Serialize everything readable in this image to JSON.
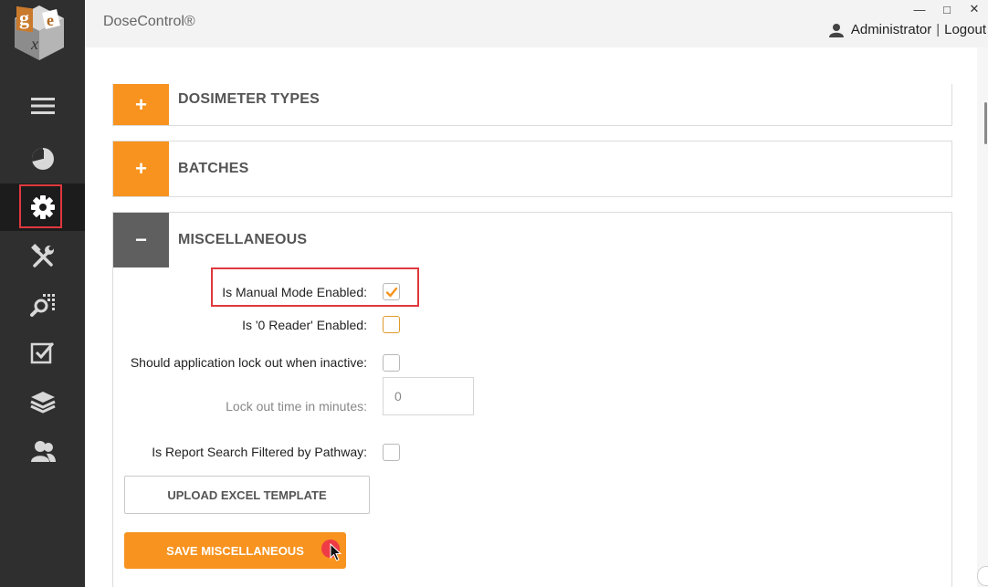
{
  "app": {
    "title": "DoseControl®",
    "logo_letters": [
      "g",
      "e",
      "x"
    ]
  },
  "window_controls": {
    "minimize": "—",
    "maximize": "□",
    "close": "✕"
  },
  "user": {
    "name": "Administrator",
    "separator": "|",
    "logout": "Logout",
    "icon": "user-icon"
  },
  "sidebar": {
    "items": [
      {
        "icon": "menu-icon",
        "active": false
      },
      {
        "icon": "dashboard-icon",
        "active": false
      },
      {
        "icon": "settings-icon",
        "active": true
      },
      {
        "icon": "tools-icon",
        "active": false
      },
      {
        "icon": "search-grid-icon",
        "active": false
      },
      {
        "icon": "checklist-icon",
        "active": false
      },
      {
        "icon": "layers-icon",
        "active": false
      },
      {
        "icon": "users-icon",
        "active": false
      }
    ]
  },
  "panels": {
    "dosimeter_types": {
      "title": "DOSIMETER TYPES",
      "toggle": "+",
      "expanded": false
    },
    "batches": {
      "title": "BATCHES",
      "toggle": "+",
      "expanded": false
    },
    "miscellaneous": {
      "title": "MISCELLANEOUS",
      "toggle": "−",
      "expanded": true
    }
  },
  "misc_form": {
    "manual_mode": {
      "label": "Is Manual Mode Enabled:",
      "checked": true
    },
    "zero_reader": {
      "label": "Is '0 Reader' Enabled:",
      "checked": false
    },
    "lock_out": {
      "label": "Should application lock out when inactive:",
      "checked": false
    },
    "lock_out_time": {
      "label": "Lock out time in minutes:",
      "placeholder": "0",
      "value": ""
    },
    "report_filter": {
      "label": "Is Report Search Filtered by Pathway:",
      "checked": false
    },
    "upload_button": "UPLOAD EXCEL TEMPLATE",
    "save_button": "SAVE MISCELLANEOUS"
  },
  "colors": {
    "accent": "#f7931e",
    "sidebar": "#2f2f2f",
    "highlight": "#e0383e"
  }
}
